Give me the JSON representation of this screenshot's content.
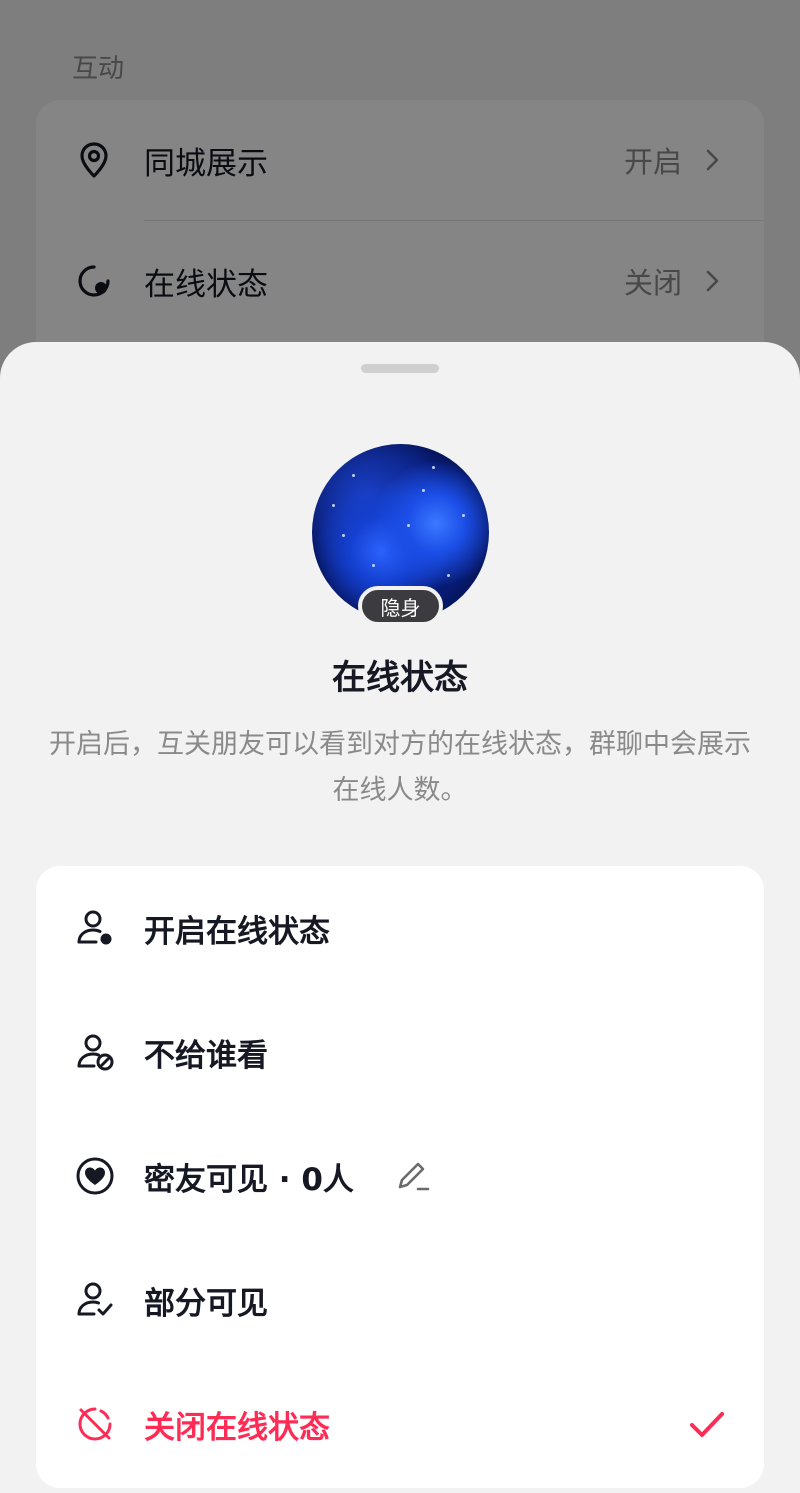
{
  "background": {
    "section_title": "互动",
    "rows": [
      {
        "icon": "location-pin-icon",
        "label": "同城展示",
        "value": "开启"
      },
      {
        "icon": "online-status-icon",
        "label": "在线状态",
        "value": "关闭"
      }
    ]
  },
  "sheet": {
    "avatar_badge": "隐身",
    "title": "在线状态",
    "description": "开启后，互关朋友可以看到对方的在线状态，群聊中会展示在线人数。",
    "options": [
      {
        "icon": "user-online-icon",
        "label": "开启在线状态"
      },
      {
        "icon": "user-block-icon",
        "label": "不给谁看"
      },
      {
        "icon": "heart-circle-icon",
        "label": "密友可见 · 0人",
        "has_edit": true
      },
      {
        "icon": "user-check-icon",
        "label": "部分可见"
      },
      {
        "icon": "status-off-icon",
        "label": "关闭在线状态",
        "selected": true
      }
    ]
  },
  "colors": {
    "accent": "#fe2c55",
    "text_primary": "#161823",
    "text_secondary": "#8a8a8a",
    "sheet_bg": "#f2f2f2"
  }
}
